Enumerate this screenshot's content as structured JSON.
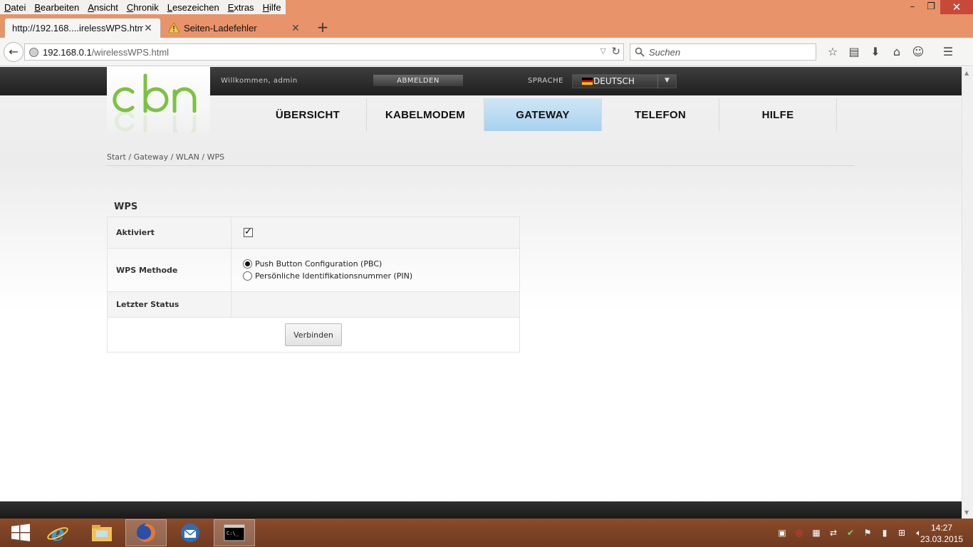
{
  "browser": {
    "menu": [
      "Datei",
      "Bearbeiten",
      "Ansicht",
      "Chronik",
      "Lesezeichen",
      "Extras",
      "Hilfe"
    ],
    "tabs": [
      {
        "label": "http://192.168....irelessWPS.html",
        "close": "✕"
      },
      {
        "label": "Seiten-Ladefehler",
        "close": "✕"
      }
    ],
    "new_tab": "+",
    "url_host": "192.168.0.1",
    "url_path": "/wirelessWPS.html",
    "search_placeholder": "Suchen"
  },
  "router": {
    "welcome": "Willkommen, admin",
    "logout": "ABMELDEN",
    "language_label": "SPRACHE",
    "language_value": "DEUTSCH",
    "nav": [
      "ÜBERSICHT",
      "KABELMODEM",
      "GATEWAY",
      "TELEFON",
      "HILFE"
    ],
    "active_nav": "GATEWAY",
    "breadcrumb": "Start / Gateway / WLAN / WPS",
    "section_title": "WPS",
    "rows": {
      "enabled_label": "Aktiviert",
      "enabled": true,
      "method_label": "WPS Methode",
      "method_options": [
        "Push Button Configuration (PBC)",
        "Persönliche Identifikationsnummer (PIN)"
      ],
      "method_selected": "Push Button Configuration (PBC)",
      "status_label": "Letzter Status",
      "status_value": ""
    },
    "connect_button": "Verbinden"
  },
  "taskbar": {
    "time": "14:27",
    "date": "23.03.2015"
  },
  "colors": {
    "firefox_titlebar": "#e8936a",
    "active_nav": "#a8d1ee",
    "logo_green": "#7cc242",
    "taskbar": "#7a4124"
  }
}
